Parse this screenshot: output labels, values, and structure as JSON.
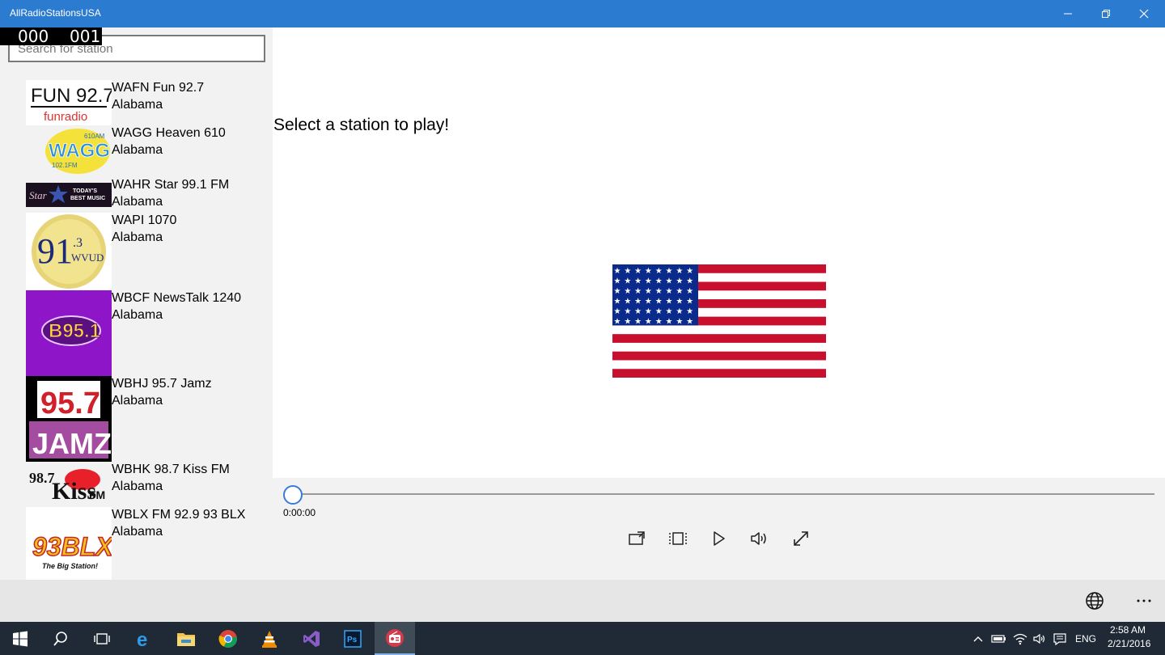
{
  "window": {
    "title": "AllRadioStationsUSA"
  },
  "counter": {
    "left": "000",
    "right": "001"
  },
  "search": {
    "placeholder": "Search for station"
  },
  "stations": [
    {
      "name": "WAFN Fun 92.7",
      "state": "Alabama",
      "logo_text": "FUN 92.7 funradio"
    },
    {
      "name": "WAGG Heaven 610",
      "state": "Alabama",
      "logo_text": "WAGG 610AM 102.1FM"
    },
    {
      "name": "WAHR Star 99.1 FM",
      "state": "Alabama",
      "logo_text": "Star 99.1 Today's Best Music"
    },
    {
      "name": "WAPI 1070",
      "state": "Alabama",
      "logo_text": "91.3 WVUD"
    },
    {
      "name": "WBCF NewsTalk 1240",
      "state": "Alabama",
      "logo_text": "B95.1"
    },
    {
      "name": "WBHJ 95.7 Jamz",
      "state": "Alabama",
      "logo_text": "95.7 JAMZ"
    },
    {
      "name": "WBHK 98.7 Kiss FM",
      "state": "Alabama",
      "logo_text": "98.7 Kiss FM"
    },
    {
      "name": "WBLX FM 92.9 93 BLX",
      "state": "Alabama",
      "logo_text": "93BLX The Big Station!"
    }
  ],
  "main": {
    "prompt": "Select a station to play!"
  },
  "player": {
    "time": "0:00:00",
    "progress": 0,
    "controls": [
      "cast-icon",
      "aspect-ratio-icon",
      "play-icon",
      "volume-icon",
      "fullscreen-icon"
    ]
  },
  "cmdbar": {
    "icons": [
      "globe-icon",
      "more-icon"
    ]
  },
  "taskbar": {
    "apps": [
      "windows-start-icon",
      "search-icon",
      "task-view-icon",
      "edge-icon",
      "file-explorer-icon",
      "chrome-icon",
      "vlc-icon",
      "visual-studio-icon",
      "photoshop-icon",
      "radio-app-icon"
    ],
    "tray": {
      "language": "ENG",
      "time": "2:58 AM",
      "date": "2/21/2016"
    }
  },
  "colors": {
    "titlebar": "#2b7bd0",
    "sidebar": "#f2f2f2",
    "taskbar": "#1f2a36",
    "accent": "#3a7bd5",
    "flag_red": "#c8102e",
    "flag_blue": "#0a2a8c"
  }
}
